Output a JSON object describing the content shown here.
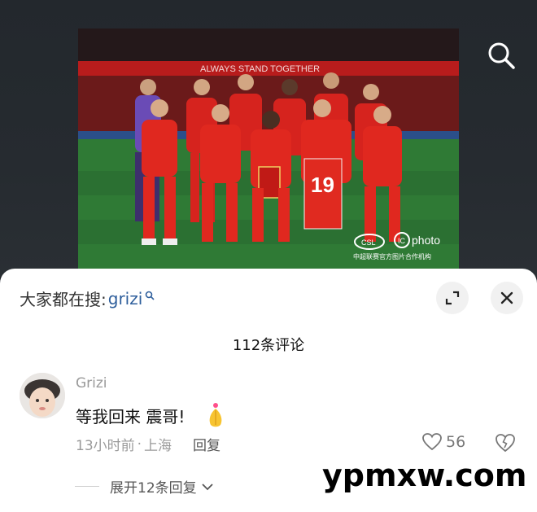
{
  "search": {
    "icon": "search-icon"
  },
  "photo": {
    "banner_text": "ALWAYS STAND TOGETHER",
    "jersey_number": "19",
    "watermark_brand": "photo",
    "watermark_league": "CSL",
    "watermark_caption": "中超联赛官方图片合作机构",
    "colors": {
      "kit": "#d6231e",
      "pitch": "#2f7a35",
      "keeper": "#6a4bb6"
    }
  },
  "sheet": {
    "trending_label": "大家都在搜:",
    "trending_keyword": "grizi",
    "trending_icon": "search-small-icon",
    "expand_icon": "fullscreen-icon",
    "close_icon": "close-icon",
    "comment_count": "112条评论"
  },
  "comment": {
    "author": "Grizi",
    "text": "等我回来 震哥!",
    "emoji": "🙏",
    "time": "13小时前",
    "separator": "·",
    "location": "上海",
    "reply_label": "回复",
    "likes": "56",
    "expand_label": "展开12条回复"
  },
  "overlay": {
    "watermark": "ypmxw.com"
  }
}
